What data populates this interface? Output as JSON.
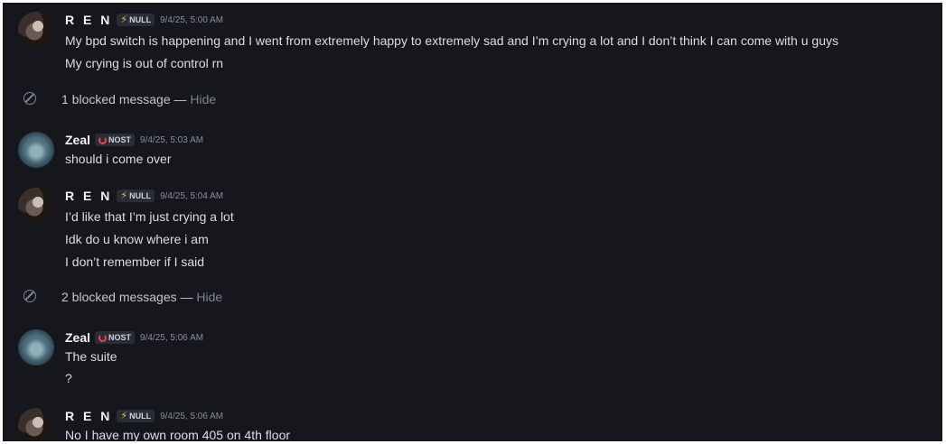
{
  "messages": [
    {
      "author": "R E N",
      "tag": {
        "icon": "lightning-icon",
        "label": "NULL",
        "icon_color": "#e5c43a"
      },
      "timestamp": "9/4/25, 5:00 AM",
      "lines": [
        "My bpd switch is happening and I went from extremely happy to extremely sad and I’m crying a lot and I don’t think I can come with u guys",
        "My crying is out of control rn"
      ]
    },
    {
      "author": "Zeal",
      "tag": {
        "icon": "nost-ring-icon",
        "label": "NOST",
        "icon_color": "#e8454a"
      },
      "timestamp": "9/4/25, 5:03 AM",
      "lines": [
        "should i come over"
      ]
    },
    {
      "author": "R E N",
      "tag": {
        "icon": "lightning-icon",
        "label": "NULL",
        "icon_color": "#e5c43a"
      },
      "timestamp": "9/4/25, 5:04 AM",
      "lines": [
        "I’d like that I’m just crying a lot",
        "Idk do u know where i am",
        "I don’t remember if I said"
      ]
    },
    {
      "author": "Zeal",
      "tag": {
        "icon": "nost-ring-icon",
        "label": "NOST",
        "icon_color": "#e8454a"
      },
      "timestamp": "9/4/25, 5:06 AM",
      "lines": [
        "The suite",
        "?"
      ]
    },
    {
      "author": "R E N",
      "tag": {
        "icon": "lightning-icon",
        "label": "NULL",
        "icon_color": "#e5c43a"
      },
      "timestamp": "9/4/25, 5:06 AM",
      "lines": [
        "No I have my own room 405 on 4th floor"
      ]
    }
  ],
  "blocked": [
    {
      "icon": "blocked-icon",
      "text": "1 blocked message —",
      "action": "Hide"
    },
    {
      "icon": "blocked-icon",
      "text": "2 blocked messages —",
      "action": "Hide"
    }
  ],
  "theme": {
    "background": "#16161d",
    "text": "#dbdee1",
    "muted": "#80848e"
  }
}
